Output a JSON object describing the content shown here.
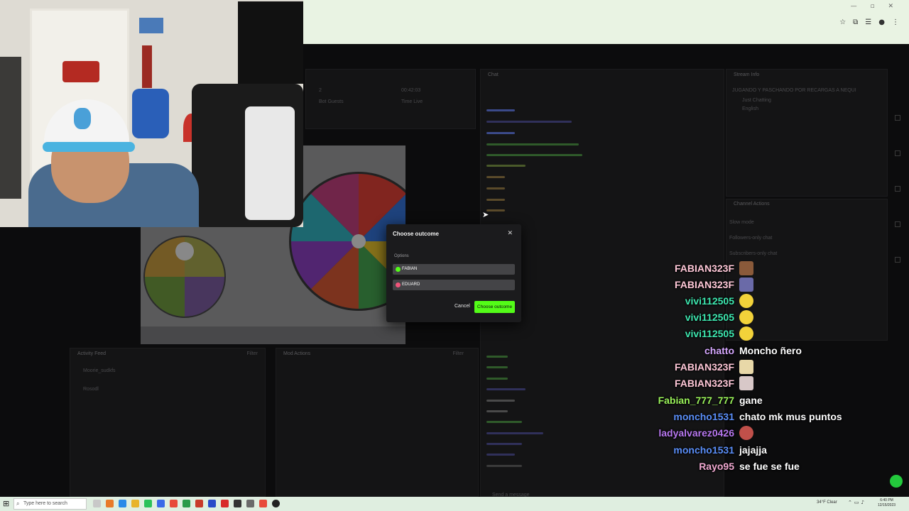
{
  "modal": {
    "title": "Choose outcome",
    "options_label": "Options",
    "options": [
      "FABIAN",
      "EDUARD"
    ],
    "cancel": "Cancel",
    "confirm": "Choose outcome"
  },
  "overlay": [
    {
      "user": "FABIAN323F"
    },
    {
      "user": "FABIAN323F"
    },
    {
      "user": "vivi112505"
    },
    {
      "user": "vivi112505"
    },
    {
      "user": "vivi112505"
    },
    {
      "user": "chatto",
      "msg": "Moncho ñero"
    },
    {
      "user": "FABIAN323F"
    },
    {
      "user": "FABIAN323F"
    },
    {
      "user": "Fabian_777_777",
      "msg": "gane"
    },
    {
      "user": "moncho1531",
      "msg": "chato mk mus puntos"
    },
    {
      "user": "ladyalvarez0426"
    },
    {
      "user": "moncho1531",
      "msg": "jajajja"
    },
    {
      "user": "Rayo95",
      "msg": "se fue se fue"
    }
  ],
  "dashboard": {
    "stat1_value": "2",
    "stat1_label": "Bot Guests",
    "stat2_value": "00:42:03",
    "stat2_label": "Time Live",
    "chat_title": "Chat",
    "chat_placeholder": "Send a message",
    "stream_info_title": "Stream Info",
    "stream_title": "JUGANDO Y PASCHANDO POR RECARGAS A NEQUI",
    "category": "Just Chatting",
    "language": "English",
    "channel_actions_title": "Channel Actions",
    "action1": "Slow mode",
    "action2": "Followers-only chat",
    "action3": "Subscribers-only chat",
    "activity_title": "Activity Feed",
    "filter_label": "Filter",
    "feed1": "Moorie_sudkfs",
    "feed2": "Rosodl",
    "mod_title": "Mod Actions"
  },
  "taskbar": {
    "search_placeholder": "Type here to search",
    "weather": "34°F Clear",
    "time": "6:40 PM",
    "date": "12/15/2023"
  }
}
